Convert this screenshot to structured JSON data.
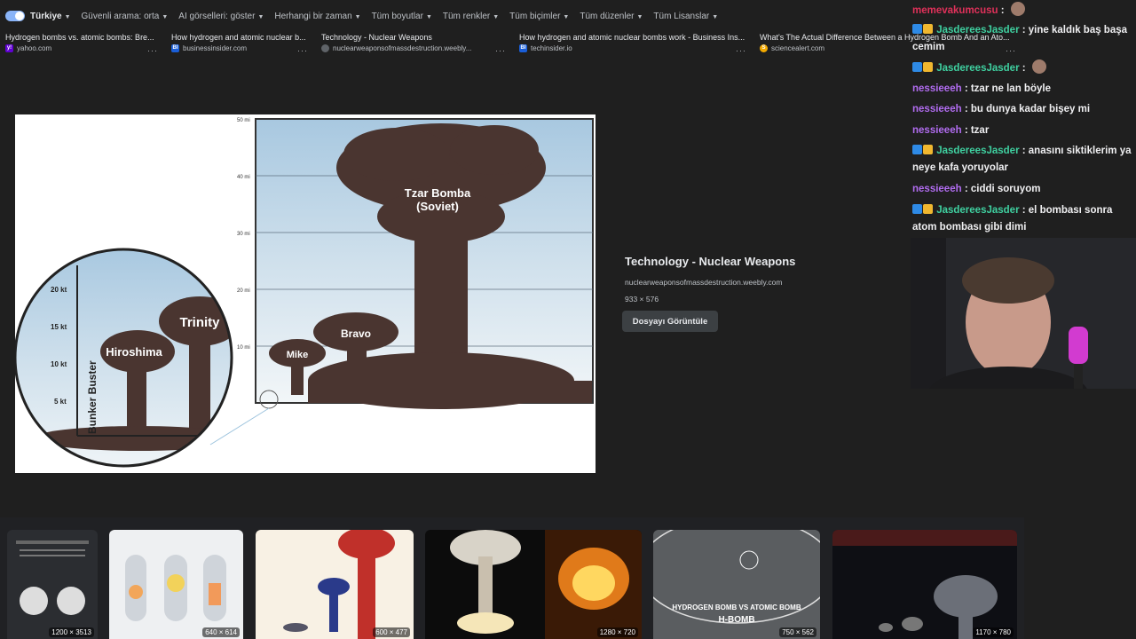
{
  "filters": {
    "region": "Türkiye",
    "items": [
      "Güvenli arama: orta",
      "AI görselleri: göster",
      "Herhangi bir zaman",
      "Tüm boyutlar",
      "Tüm renkler",
      "Tüm biçimler",
      "Tüm düzenler",
      "Tüm Lisanslar"
    ]
  },
  "results": [
    {
      "title": "Hydrogen bombs vs. atomic bombs: Bre...",
      "source": "yahoo.com",
      "fav": "y!"
    },
    {
      "title": "How hydrogen and atomic nuclear b...",
      "source": "businessinsider.com",
      "fav": "BI"
    },
    {
      "title": "Technology - Nuclear Weapons",
      "source": "nuclearweaponsofmassdestruction.weebly...",
      "fav": ""
    },
    {
      "title": "How hydrogen and atomic nuclear bombs work - Business Ins...",
      "source": "techinsider.io",
      "fav": "BI"
    },
    {
      "title": "What's The Actual Difference Between a Hydrogen Bomb And an Ato...",
      "source": "sciencealert.com",
      "fav": "S"
    }
  ],
  "more_label": "···",
  "preview": {
    "title": "Technology - Nuclear Weapons",
    "domain": "nuclearweaponsofmassdestruction.weebly.com",
    "dims": "933 × 576",
    "button": "Dosyayı Görüntüle",
    "chart_text": {
      "y_ticks_right": [
        "50 mi",
        "40 mi",
        "30 mi",
        "20 mi",
        "10 mi"
      ],
      "y_ticks_left": [
        "20 kt",
        "15 kt",
        "10 kt",
        "5 kt"
      ],
      "labels": [
        "Tzar Bomba",
        "(Soviet)",
        "Bravo",
        "Mike",
        "Trinity",
        "Hiroshima",
        "Bunker Buster"
      ]
    }
  },
  "thumbs": [
    {
      "dims": "1200 × 3513"
    },
    {
      "dims": "640 × 614"
    },
    {
      "dims": "600 × 477"
    },
    {
      "dims": "1280 × 720"
    },
    {
      "dims": "750 × 562",
      "caption": "HYDROGEN BOMB VS ATOMIC BOMB",
      "caption2": "H-BOMB"
    },
    {
      "dims": "1170 × 780"
    }
  ],
  "chat": [
    {
      "user": "memevakumcusu",
      "color": "#e0315a",
      "text": ":",
      "badges": 0
    },
    {
      "user": "JasdereesJasder",
      "color": "#3fd0a0",
      "text": ": yine kaldık baş başa cemim",
      "badges": 2
    },
    {
      "user": "JasdereesJasder",
      "color": "#3fd0a0",
      "text": ":",
      "badges": 2
    },
    {
      "user": "nessieeeh",
      "color": "#b16cf0",
      "text": ": tzar ne lan böyle",
      "badges": 0
    },
    {
      "user": "nessieeeh",
      "color": "#b16cf0",
      "text": ": bu dunya kadar bişey mi",
      "badges": 0
    },
    {
      "user": "nessieeeh",
      "color": "#b16cf0",
      "text": ": tzar",
      "badges": 0
    },
    {
      "user": "JasdereesJasder",
      "color": "#3fd0a0",
      "text": ": anasını siktiklerim ya neye kafa yoruyolar",
      "badges": 2
    },
    {
      "user": "nessieeeh",
      "color": "#b16cf0",
      "text": ": ciddi soruyom",
      "badges": 0
    },
    {
      "user": "JasdereesJasder",
      "color": "#3fd0a0",
      "text": ": el bombası sonra atom bombası gibi dimi",
      "badges": 2
    }
  ]
}
